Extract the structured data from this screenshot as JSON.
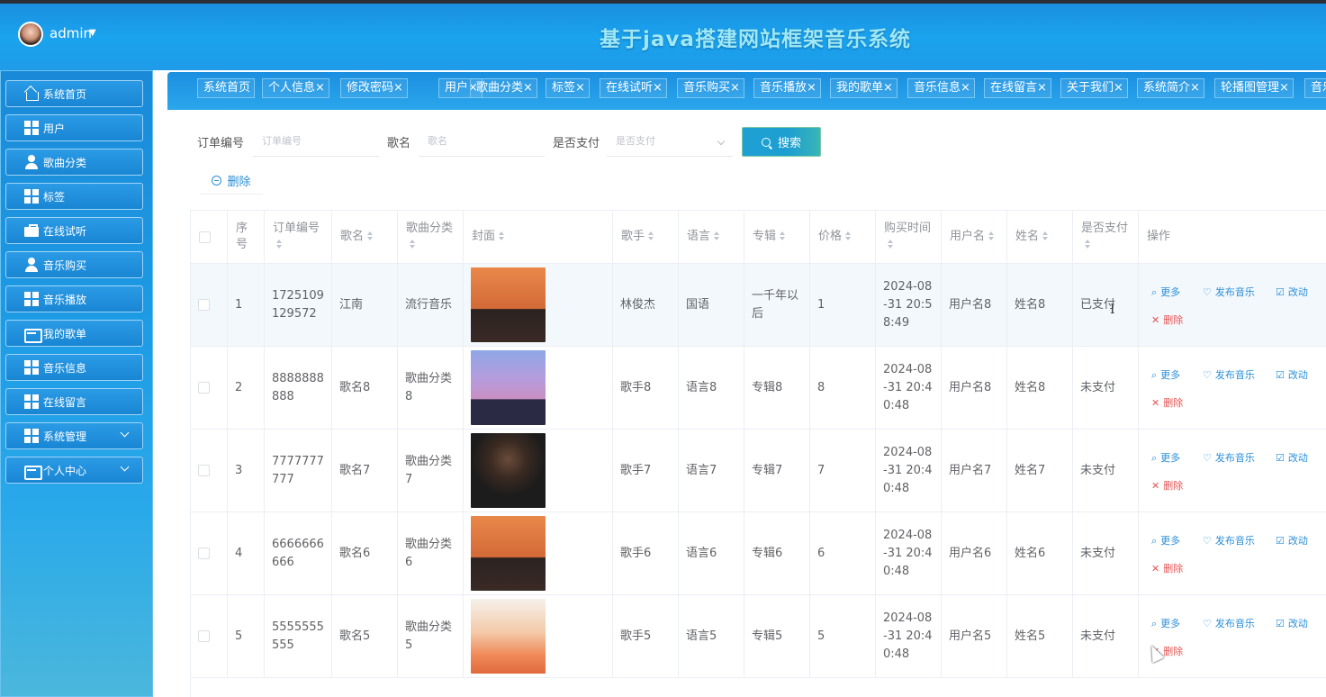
{
  "header": {
    "user": "admin",
    "title": "基于java搭建网站框架音乐系统",
    "colors": {
      "header_bg": "#1b8fe0",
      "title": "#9fe8f4",
      "accent": "#2a8fd8"
    }
  },
  "sidebar": {
    "items": [
      {
        "label": "系统首页",
        "icon": "home-icon"
      },
      {
        "label": "用户",
        "icon": "grid-icon"
      },
      {
        "label": "歌曲分类",
        "icon": "user-icon"
      },
      {
        "label": "标签",
        "icon": "grid-icon"
      },
      {
        "label": "在线试听",
        "icon": "briefcase-icon"
      },
      {
        "label": "音乐购买",
        "icon": "user-icon"
      },
      {
        "label": "音乐播放",
        "icon": "grid-icon"
      },
      {
        "label": "我的歌单",
        "icon": "wallet-icon"
      },
      {
        "label": "音乐信息",
        "icon": "grid-icon"
      },
      {
        "label": "在线留言",
        "icon": "grid-icon"
      },
      {
        "label": "系统管理",
        "icon": "grid-icon"
      },
      {
        "label": "个人中心",
        "icon": "wallet-icon"
      }
    ]
  },
  "tabs": [
    "系统首页",
    "个人信息×",
    "修改密码×",
    "用户×",
    "歌曲分类×",
    "标签×",
    "在线试听×",
    "音乐购买×",
    "音乐播放×",
    "我的歌单×",
    "音乐信息×",
    "在线留言×",
    "关于我们×",
    "系统简介×",
    "轮播图管理×",
    "音乐"
  ],
  "search": {
    "order_label": "订单编号",
    "order_placeholder": "订单编号",
    "song_label": "歌名",
    "song_placeholder": "歌名",
    "paid_label": "是否支付",
    "paid_placeholder": "是否支付",
    "search_button": "搜索",
    "delete_button": "删除"
  },
  "table": {
    "headers": {
      "index": "序号",
      "order": "订单编号",
      "song": "歌名",
      "category": "歌曲分类",
      "cover": "封面",
      "singer": "歌手",
      "language": "语言",
      "album": "专辑",
      "price": "价格",
      "time": "购买时间",
      "username": "用户名",
      "name": "姓名",
      "paid": "是否支付",
      "actions": "操作"
    },
    "actions": {
      "more": "更多",
      "publish": "发布音乐",
      "edit": "改动",
      "delete": "删除"
    },
    "rows": [
      {
        "index": "1",
        "order": "1725109129572",
        "song": "江南",
        "category": "流行音乐",
        "singer": "林俊杰",
        "language": "国语",
        "album": "一千年以后",
        "price": "1",
        "time": "2024-08-31 20:58:49",
        "username": "用户名8",
        "name": "姓名8",
        "paid": "已支付"
      },
      {
        "index": "2",
        "order": "8888888888",
        "song": "歌名8",
        "category": "歌曲分类8",
        "singer": "歌手8",
        "language": "语言8",
        "album": "专辑8",
        "price": "8",
        "time": "2024-08-31 20:40:48",
        "username": "用户名8",
        "name": "姓名8",
        "paid": "未支付"
      },
      {
        "index": "3",
        "order": "7777777777",
        "song": "歌名7",
        "category": "歌曲分类7",
        "singer": "歌手7",
        "language": "语言7",
        "album": "专辑7",
        "price": "7",
        "time": "2024-08-31 20:40:48",
        "username": "用户名7",
        "name": "姓名7",
        "paid": "未支付"
      },
      {
        "index": "4",
        "order": "6666666666",
        "song": "歌名6",
        "category": "歌曲分类6",
        "singer": "歌手6",
        "language": "语言6",
        "album": "专辑6",
        "price": "6",
        "time": "2024-08-31 20:40:48",
        "username": "用户名6",
        "name": "姓名6",
        "paid": "未支付"
      },
      {
        "index": "5",
        "order": "5555555555",
        "song": "歌名5",
        "category": "歌曲分类5",
        "singer": "歌手5",
        "language": "语言5",
        "album": "专辑5",
        "price": "5",
        "time": "2024-08-31 20:40:48",
        "username": "用户名5",
        "name": "姓名5",
        "paid": "未支付"
      }
    ]
  }
}
